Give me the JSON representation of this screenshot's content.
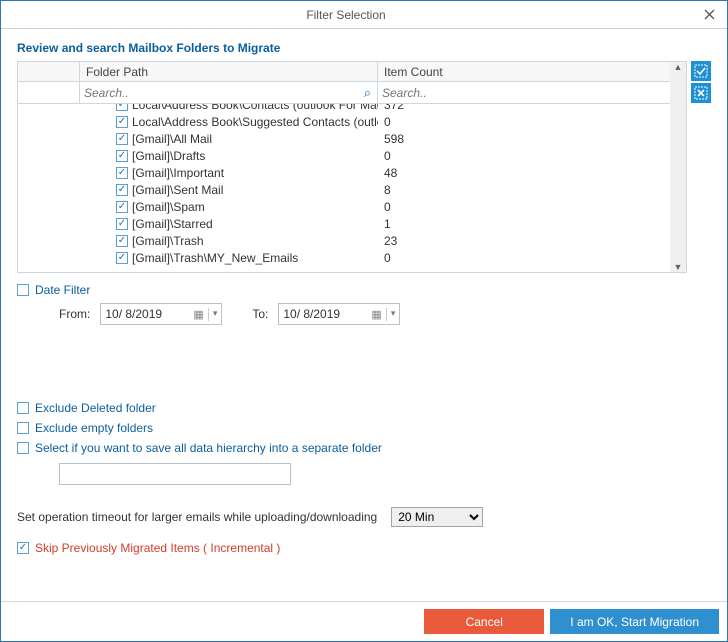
{
  "window": {
    "title": "Filter Selection"
  },
  "section_title": "Review and search Mailbox Folders to Migrate",
  "grid": {
    "headers": {
      "path": "Folder Path",
      "count": "Item Count"
    },
    "search_placeholder": "Search..",
    "rows": [
      {
        "checked": true,
        "path": "Local\\Address Book\\Contacts (outlook For Mac Archi...",
        "count": "372",
        "cut": true
      },
      {
        "checked": true,
        "path": "Local\\Address Book\\Suggested Contacts (outlook For...",
        "count": "0",
        "cut": false
      },
      {
        "checked": true,
        "path": "[Gmail]\\All Mail",
        "count": "598",
        "cut": false
      },
      {
        "checked": true,
        "path": "[Gmail]\\Drafts",
        "count": "0",
        "cut": false
      },
      {
        "checked": true,
        "path": "[Gmail]\\Important",
        "count": "48",
        "cut": false
      },
      {
        "checked": true,
        "path": "[Gmail]\\Sent Mail",
        "count": "8",
        "cut": false
      },
      {
        "checked": true,
        "path": "[Gmail]\\Spam",
        "count": "0",
        "cut": false
      },
      {
        "checked": true,
        "path": "[Gmail]\\Starred",
        "count": "1",
        "cut": false
      },
      {
        "checked": true,
        "path": "[Gmail]\\Trash",
        "count": "23",
        "cut": false
      },
      {
        "checked": true,
        "path": "[Gmail]\\Trash\\MY_New_Emails",
        "count": "0",
        "cut": false
      }
    ]
  },
  "date_filter": {
    "label": "Date Filter",
    "checked": false,
    "from_label": "From:",
    "to_label": "To:",
    "from_value": "10/  8/2019",
    "to_value": "10/  8/2019"
  },
  "options": {
    "exclude_deleted": {
      "label": "Exclude Deleted folder",
      "checked": false
    },
    "exclude_empty": {
      "label": "Exclude empty folders",
      "checked": false
    },
    "separate_folder": {
      "label": "Select if you want to save all data hierarchy into a separate folder",
      "checked": false,
      "value": ""
    }
  },
  "timeout": {
    "label": "Set operation timeout for larger emails while uploading/downloading",
    "value": "20 Min",
    "options": [
      "20 Min"
    ]
  },
  "skip_prev": {
    "label": "Skip Previously Migrated Items ( Incremental )",
    "checked": true
  },
  "buttons": {
    "cancel": "Cancel",
    "ok": "I am OK, Start Migration"
  }
}
